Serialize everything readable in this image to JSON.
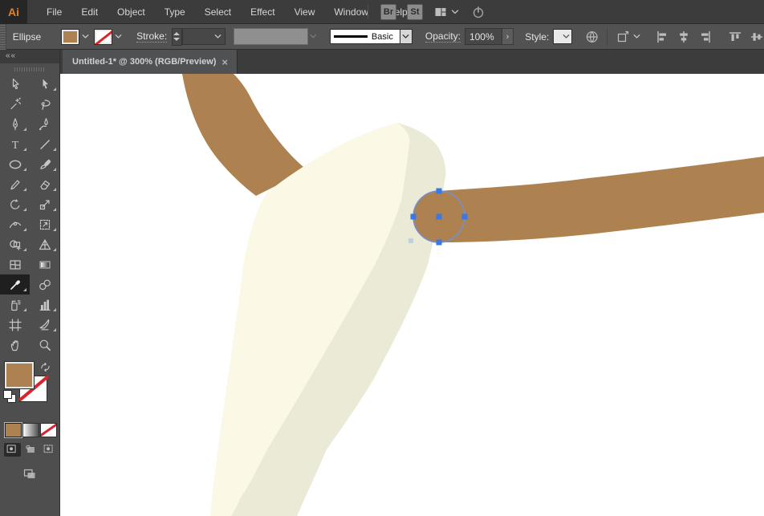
{
  "app": {
    "logo_text": "Ai"
  },
  "menubar": {
    "items": [
      "File",
      "Edit",
      "Object",
      "Type",
      "Select",
      "Effect",
      "View",
      "Window",
      "Help"
    ],
    "bridge_label": "Br",
    "stock_label": "St"
  },
  "control_bar": {
    "context_label": "Ellipse",
    "fill_color": "#ad8150",
    "stroke_is_none": true,
    "stroke_label": "Stroke:",
    "stroke_width_value": "",
    "brush_name": "Basic",
    "opacity_label": "Opacity:",
    "opacity_value": "100%",
    "next_glyph": "›",
    "style_label": "Style:"
  },
  "tabbar": {
    "title": "Untitled-1* @ 300% (RGB/Preview)",
    "close_glyph": "×"
  },
  "toolbar": {
    "collapse_glyph": "««",
    "active_tool": "eyedropper",
    "fill_color": "#ad8150",
    "tools": [
      {
        "id": "selection",
        "name": "Selection Tool",
        "flyout": false
      },
      {
        "id": "direct-selection",
        "name": "Direct Selection Tool",
        "flyout": true
      },
      {
        "id": "magic-wand",
        "name": "Magic Wand Tool",
        "flyout": false
      },
      {
        "id": "lasso",
        "name": "Lasso Tool",
        "flyout": false
      },
      {
        "id": "pen",
        "name": "Pen Tool",
        "flyout": true
      },
      {
        "id": "curvature",
        "name": "Curvature Tool",
        "flyout": false
      },
      {
        "id": "type",
        "name": "Type Tool",
        "flyout": true
      },
      {
        "id": "line-segment",
        "name": "Line Segment Tool",
        "flyout": true
      },
      {
        "id": "ellipse",
        "name": "Ellipse Tool",
        "flyout": true
      },
      {
        "id": "paintbrush",
        "name": "Paintbrush Tool",
        "flyout": true
      },
      {
        "id": "shaper",
        "name": "Shaper Tool",
        "flyout": true
      },
      {
        "id": "eraser",
        "name": "Eraser Tool",
        "flyout": true
      },
      {
        "id": "rotate",
        "name": "Rotate Tool",
        "flyout": true
      },
      {
        "id": "scale",
        "name": "Scale Tool",
        "flyout": true
      },
      {
        "id": "width",
        "name": "Width Tool",
        "flyout": true
      },
      {
        "id": "free-transform",
        "name": "Free Transform Tool",
        "flyout": true
      },
      {
        "id": "shape-builder",
        "name": "Shape Builder Tool",
        "flyout": true
      },
      {
        "id": "perspective-grid",
        "name": "Perspective Grid Tool",
        "flyout": true
      },
      {
        "id": "mesh",
        "name": "Mesh Tool",
        "flyout": false
      },
      {
        "id": "gradient",
        "name": "Gradient Tool",
        "flyout": false
      },
      {
        "id": "eyedropper",
        "name": "Eyedropper Tool",
        "flyout": true
      },
      {
        "id": "blend",
        "name": "Blend Tool",
        "flyout": false
      },
      {
        "id": "symbol-sprayer",
        "name": "Symbol Sprayer Tool",
        "flyout": true
      },
      {
        "id": "column-graph",
        "name": "Column Graph Tool",
        "flyout": true
      },
      {
        "id": "artboard",
        "name": "Artboard Tool",
        "flyout": false
      },
      {
        "id": "slice",
        "name": "Slice Tool",
        "flyout": true
      },
      {
        "id": "hand",
        "name": "Hand Tool",
        "flyout": false
      },
      {
        "id": "zoom",
        "name": "Zoom Tool",
        "flyout": false
      }
    ]
  },
  "canvas": {
    "artboard_color": "#ffffff",
    "shapes": {
      "branch_color": "#ad8150",
      "horn_light_color": "#fbf9e6",
      "horn_shadow_color": "#ebead7",
      "ellipse_fill": "#ad8150"
    },
    "selection": {
      "handle_color": "#3b78e7",
      "path_color": "#7b8fc7",
      "ghost_handle_color": "#9db8e8"
    }
  },
  "icons": {
    "chevron-down": "⌄",
    "close": "×",
    "collapse-panel": "«",
    "next-arrow": "›",
    "named": [
      "bridge-icon",
      "stock-icon",
      "workspace-switcher-icon",
      "power-icon",
      "globe-icon",
      "corner-widget-icon",
      "align-left-icon",
      "align-center-icon",
      "align-right-icon",
      "align-top-icon",
      "align-middle-icon",
      "swap-fill-stroke-icon",
      "default-fill-stroke-icon",
      "screen-mode-icon",
      "draw-normal-icon",
      "draw-behind-icon",
      "draw-inside-icon"
    ]
  }
}
